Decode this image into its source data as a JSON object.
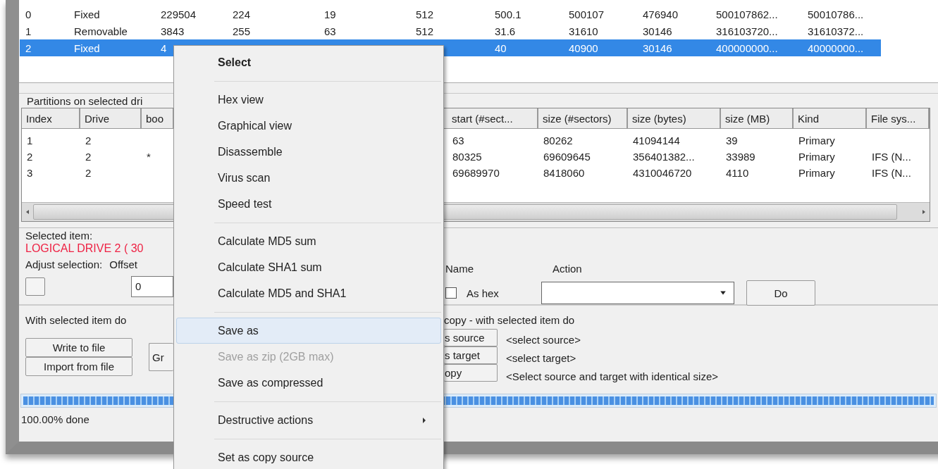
{
  "drives": {
    "rows": [
      {
        "selected": false,
        "cells": [
          "0",
          "Fixed",
          "229504",
          "224",
          "19",
          "512",
          "500.1",
          "500107",
          "476940",
          "500107862...",
          "50010786..."
        ]
      },
      {
        "selected": false,
        "cells": [
          "1",
          "Removable",
          "3843",
          "255",
          "63",
          "512",
          "31.6",
          "31610",
          "30146",
          "316103720...",
          "31610372..."
        ]
      },
      {
        "selected": true,
        "cells": [
          "2",
          "Fixed",
          "4",
          null,
          null,
          null,
          "40",
          "40900",
          "30146",
          "400000000...",
          "40000000..."
        ]
      }
    ]
  },
  "partitions": {
    "title": "Partitions on selected dri",
    "columns": [
      "Index",
      "Drive",
      "boo",
      "start (#sect...",
      "size (#sectors)",
      "size (bytes)",
      "size (MB)",
      "Kind",
      "File sys..."
    ],
    "rows": [
      {
        "cells": [
          "1",
          "2",
          null,
          "63",
          "80262",
          "41094144",
          "39",
          "Primary",
          null
        ]
      },
      {
        "cells": [
          "2",
          "2",
          "*",
          "80325",
          "69609645",
          "356401382...",
          "33989",
          "Primary",
          "IFS (N..."
        ]
      },
      {
        "cells": [
          "3",
          "2",
          null,
          "69689970",
          "8418060",
          "4310046720",
          "4110",
          "Primary",
          "IFS (N..."
        ]
      }
    ]
  },
  "selected_item": {
    "label": "Selected item:",
    "value": "LOGICAL DRIVE 2  ( 30"
  },
  "adjust": {
    "label": "Adjust selection:",
    "offset_label": "Offset",
    "offset_value": "0",
    "name_label": "Name",
    "as_hex": {
      "label": "As hex",
      "checked": false
    },
    "action_label": "Action",
    "do_button": "Do"
  },
  "item_actions": {
    "title": "With selected item do",
    "buttons": [
      "Write to file",
      "Import from file"
    ],
    "partial_button": "Gr"
  },
  "copy": {
    "title": "copy - with selected item do",
    "buttons": [
      "s source",
      "s target",
      "opy"
    ],
    "labels": [
      "<select source>",
      "<select target>",
      "<Select source and target with identical size>"
    ]
  },
  "progress": {
    "level": 1
  },
  "status": "100.00% done",
  "context_menu": [
    {
      "kind": "item",
      "label": "Select",
      "default": true,
      "selected": false,
      "disabled": false,
      "submenu": false
    },
    {
      "kind": "separator"
    },
    {
      "kind": "item",
      "label": "Hex view",
      "default": false,
      "selected": false,
      "disabled": false,
      "submenu": false
    },
    {
      "kind": "item",
      "label": "Graphical view",
      "default": false,
      "selected": false,
      "disabled": false,
      "submenu": false
    },
    {
      "kind": "item",
      "label": "Disassemble",
      "default": false,
      "selected": false,
      "disabled": false,
      "submenu": false
    },
    {
      "kind": "item",
      "label": "Virus scan",
      "default": false,
      "selected": false,
      "disabled": false,
      "submenu": false
    },
    {
      "kind": "item",
      "label": "Speed test",
      "default": false,
      "selected": false,
      "disabled": false,
      "submenu": false
    },
    {
      "kind": "separator"
    },
    {
      "kind": "item",
      "label": "Calculate MD5 sum",
      "default": false,
      "selected": false,
      "disabled": false,
      "submenu": false
    },
    {
      "kind": "item",
      "label": "Calculate SHA1 sum",
      "default": false,
      "selected": false,
      "disabled": false,
      "submenu": false
    },
    {
      "kind": "item",
      "label": "Calculate MD5 and SHA1",
      "default": false,
      "selected": false,
      "disabled": false,
      "submenu": false
    },
    {
      "kind": "separator"
    },
    {
      "kind": "item",
      "label": "Save as",
      "default": false,
      "selected": true,
      "disabled": false,
      "submenu": false
    },
    {
      "kind": "item",
      "label": "Save as zip (2GB max)",
      "default": false,
      "selected": false,
      "disabled": true,
      "submenu": false
    },
    {
      "kind": "item",
      "label": "Save as compressed",
      "default": false,
      "selected": false,
      "disabled": false,
      "submenu": false
    },
    {
      "kind": "separator"
    },
    {
      "kind": "item",
      "label": "Destructive actions",
      "default": false,
      "selected": false,
      "disabled": false,
      "submenu": true
    },
    {
      "kind": "separator"
    },
    {
      "kind": "item",
      "label": "Set as copy source",
      "default": false,
      "selected": false,
      "disabled": false,
      "submenu": false
    }
  ]
}
